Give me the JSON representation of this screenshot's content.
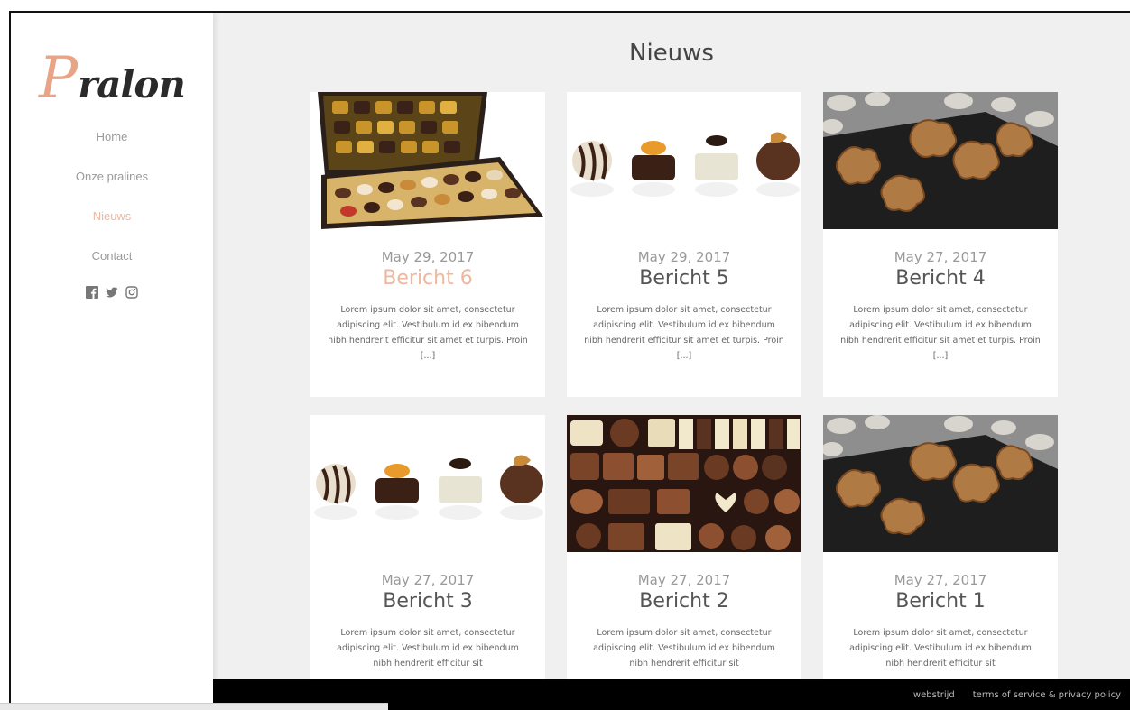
{
  "brand": {
    "logo_initial": "P",
    "logo_rest": "ralon",
    "accent": "#f0b79f"
  },
  "nav": {
    "items": [
      {
        "label": "Home",
        "active": false
      },
      {
        "label": "Onze pralines",
        "active": false
      },
      {
        "label": "Nieuws",
        "active": true
      },
      {
        "label": "Contact",
        "active": false
      }
    ],
    "social": [
      "facebook-icon",
      "twitter-icon",
      "instagram-icon"
    ]
  },
  "page": {
    "title": "Nieuws"
  },
  "posts": [
    {
      "date": "May 29, 2017",
      "title": "Bericht 6",
      "accent": true,
      "image": "chocolate-box",
      "excerpt": "Lorem ipsum dolor sit amet, consectetur adipiscing elit. Vestibulum id ex bibendum nibh hendrerit efficitur sit amet et turpis. Proin [...]"
    },
    {
      "date": "May 29, 2017",
      "title": "Bericht 5",
      "accent": false,
      "image": "pralines-row",
      "excerpt": "Lorem ipsum dolor sit amet, consectetur adipiscing elit. Vestibulum id ex bibendum nibh hendrerit efficitur sit amet et turpis. Proin [...]"
    },
    {
      "date": "May 27, 2017",
      "title": "Bericht 4",
      "accent": false,
      "image": "nut-clusters",
      "excerpt": "Lorem ipsum dolor sit amet, consectetur adipiscing elit. Vestibulum id ex bibendum nibh hendrerit efficitur sit amet et turpis. Proin [...]"
    },
    {
      "date": "May 27, 2017",
      "title": "Bericht 3",
      "accent": false,
      "image": "pralines-row",
      "excerpt": "Lorem ipsum dolor sit amet, consectetur adipiscing elit. Vestibulum id ex bibendum nibh hendrerit efficitur sit"
    },
    {
      "date": "May 27, 2017",
      "title": "Bericht 2",
      "accent": false,
      "image": "chocolate-assortment",
      "excerpt": "Lorem ipsum dolor sit amet, consectetur adipiscing elit. Vestibulum id ex bibendum nibh hendrerit efficitur sit"
    },
    {
      "date": "May 27, 2017",
      "title": "Bericht 1",
      "accent": false,
      "image": "nut-clusters",
      "excerpt": "Lorem ipsum dolor sit amet, consectetur adipiscing elit. Vestibulum id ex bibendum nibh hendrerit efficitur sit"
    }
  ],
  "footer": {
    "credit": "webstrijd",
    "legal": "terms of service & privacy policy"
  }
}
